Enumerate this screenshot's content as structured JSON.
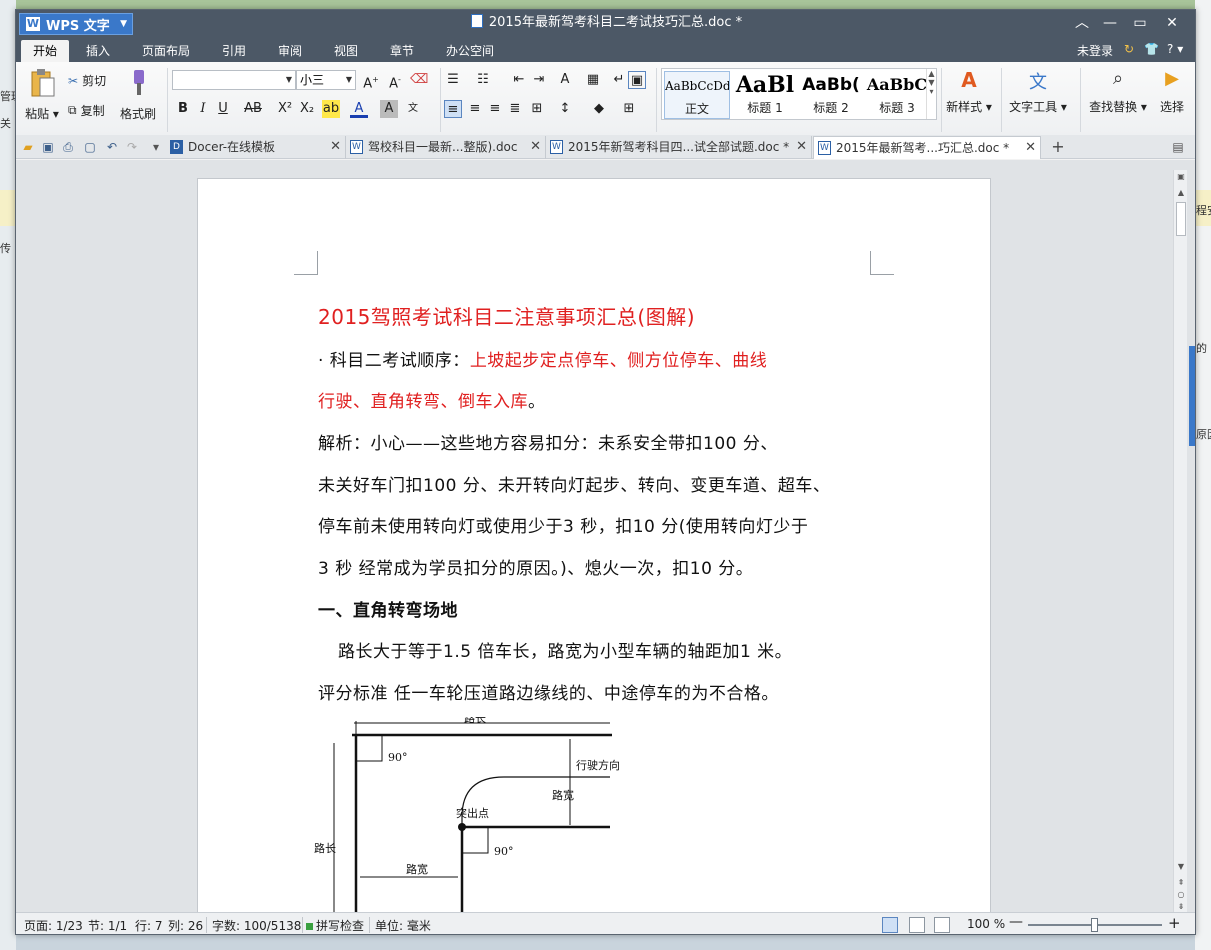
{
  "background": {
    "left_texts": [
      "管理",
      "关",
      "传"
    ],
    "right_texts": [
      "",
      "程安",
      "的",
      "原因"
    ]
  },
  "app": {
    "menu_button": "WPS 文字",
    "window_title": "2015年最新驾考科目二考试技巧汇总.doc *"
  },
  "menubar": {
    "items": [
      "开始",
      "插入",
      "页面布局",
      "引用",
      "审阅",
      "视图",
      "章节",
      "办公空间"
    ],
    "login": "未登录",
    "help": "?"
  },
  "ribbon": {
    "paste": "粘贴",
    "cut": "剪切",
    "copy": "复制",
    "format_painter": "格式刷",
    "font_name": "",
    "font_size": "小三",
    "styles": [
      {
        "sample": "AaBbCcDd",
        "name": "正文"
      },
      {
        "sample": "AaBl",
        "name": "标题 1"
      },
      {
        "sample": "AaBb(",
        "name": "标题 2"
      },
      {
        "sample": "AaBbC",
        "name": "标题 3"
      }
    ],
    "new_style": "新样式",
    "text_tools": "文字工具",
    "find_replace": "查找替换",
    "select": "选择"
  },
  "tabs": [
    {
      "label": "Docer-在线模板",
      "active": false
    },
    {
      "label": "驾校科目一最新...整版).doc",
      "active": false
    },
    {
      "label": "2015年新驾考科目四...试全部试题.doc *",
      "active": false
    },
    {
      "label": "2015年最新驾考...巧汇总.doc *",
      "active": true
    }
  ],
  "document": {
    "heading": "2015驾照考试科目二注意事项汇总(图解)",
    "order_label": "· 科目二考试顺序：",
    "order_red_1": "上坡起步定点停车、侧方位停车、曲线",
    "order_red_2": "行驶、直角转弯、倒车入库",
    "order_end": "。",
    "analysis_lines": [
      "解析：小心——这些地方容易扣分：未系安全带扣100 分、",
      "未关好车门扣100 分、未开转向灯起步、转向、变更车道、超车、",
      "停车前未使用转向灯或使用少于3 秒，扣10 分(使用转向灯少于",
      "3 秒  经常成为学员扣分的原因。)、熄火一次，扣10 分。"
    ],
    "section_title": "一、直角转弯场地",
    "road_line": "路长大于等于1.5 倍车长，路宽为小型车辆的轴距加1 米。",
    "scoring_line": "评分标准  任一车轮压道路边缘线的、中途停车的为不合格。",
    "diagram": {
      "road_length_top": "路长",
      "angle_1": "90°",
      "direction": "行驶方向",
      "road_width_right": "路宽",
      "protrusion": "突出点",
      "angle_2": "90°",
      "road_length_left": "路长",
      "road_width_bottom": "路宽"
    }
  },
  "statusbar": {
    "page": "页面: 1/23",
    "section": "节: 1/1",
    "row": "行: 7",
    "col": "列: 26",
    "words": "字数: 100/5138",
    "spell": "拼写检查",
    "unit": "单位: 毫米",
    "zoom": "100 %"
  }
}
